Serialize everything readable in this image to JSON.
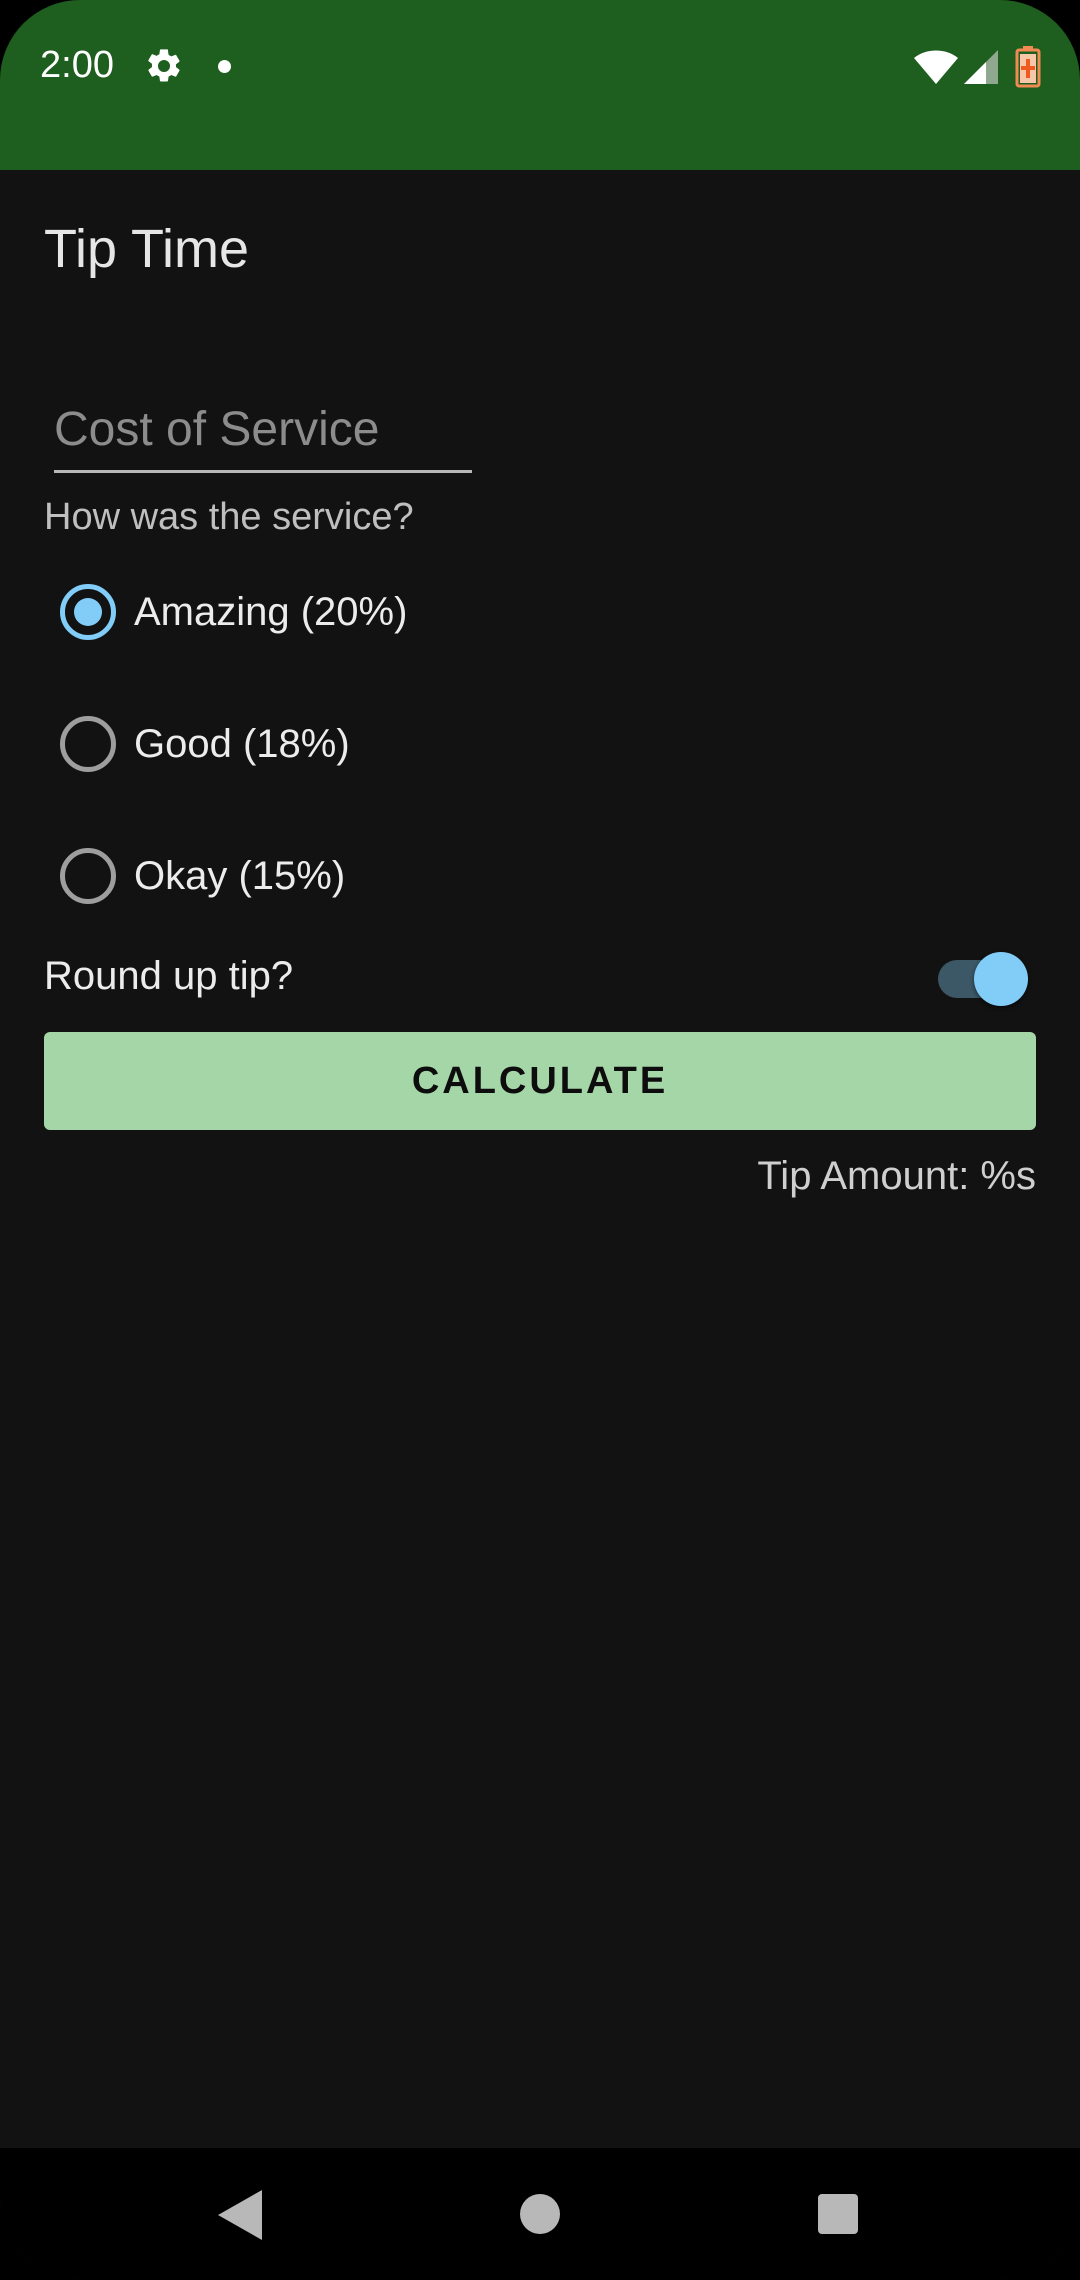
{
  "status_bar": {
    "time": "2:00",
    "icons": [
      "gear-icon",
      "notification-dot-icon",
      "wifi-icon",
      "signal-icon",
      "battery-charging-icon"
    ],
    "background_color": "#1e5e1e"
  },
  "app": {
    "title": "Tip Time"
  },
  "cost_field": {
    "value": "",
    "placeholder": "Cost of Service"
  },
  "service_question": "How was the service?",
  "tip_options": [
    {
      "label": "Amazing (20%)",
      "selected": true
    },
    {
      "label": "Good (18%)",
      "selected": false
    },
    {
      "label": "Okay (15%)",
      "selected": false
    }
  ],
  "round_up": {
    "label": "Round up tip?",
    "enabled": true
  },
  "calculate_button": {
    "label": "CALCULATE"
  },
  "tip_amount": {
    "text": "Tip Amount: %s"
  },
  "nav_bar": {
    "icons": [
      "back-icon",
      "home-icon",
      "recents-icon"
    ]
  },
  "colors": {
    "accent": "#81cdf8",
    "button": "#a5d6a7",
    "background": "#121212"
  }
}
